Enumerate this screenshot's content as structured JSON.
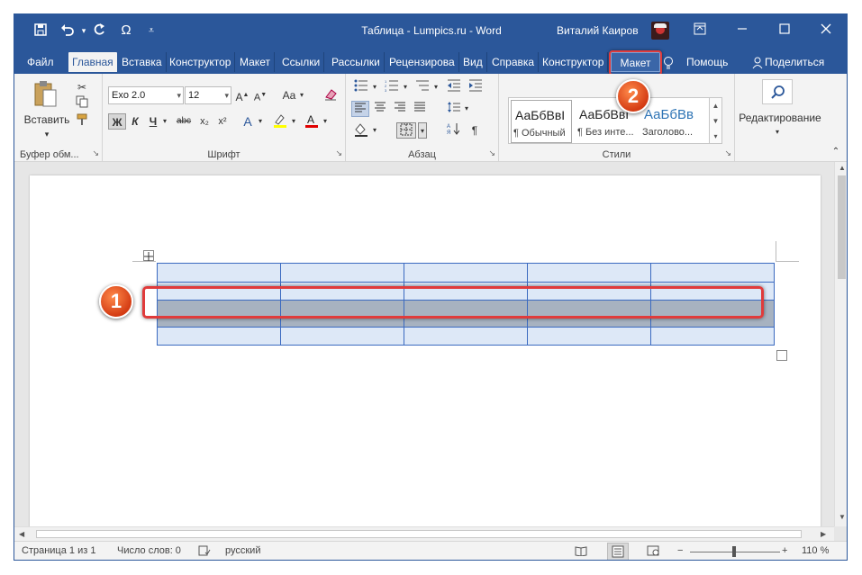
{
  "titlebar": {
    "title": "Таблица - Lumpics.ru  -  Word",
    "user": "Виталий Каиров",
    "qa_save_icon": "save-icon",
    "qa_undo_icon": "undo-icon",
    "qa_redo_icon": "redo-icon",
    "qa_symbol": "Ω",
    "qa_more": "⩡"
  },
  "tabs": [
    {
      "label": "Файл"
    },
    {
      "label": "Главная"
    },
    {
      "label": "Вставка"
    },
    {
      "label": "Конструктор"
    },
    {
      "label": "Макет"
    },
    {
      "label": "Ссылки"
    },
    {
      "label": "Рассылки"
    },
    {
      "label": "Рецензирова"
    },
    {
      "label": "Вид"
    },
    {
      "label": "Справка"
    },
    {
      "label": "Конструктор"
    },
    {
      "label": "Макет"
    },
    {
      "label": "Помощь"
    },
    {
      "label": "Поделиться"
    }
  ],
  "ribbon": {
    "clipboard": {
      "paste": "Вставить",
      "label": "Буфер обм..."
    },
    "font": {
      "name": "Exo 2.0",
      "size": "12",
      "aa": "Aa",
      "label": "Шрифт",
      "bold": "Ж",
      "italic": "К",
      "underline": "Ч",
      "strike": "abc",
      "sub": "x₂",
      "sup": "x²"
    },
    "paragraph": {
      "label": "Абзац",
      "pilcrow": "¶"
    },
    "styles": {
      "label": "Стили",
      "items": [
        {
          "sample": "АаБбВвІ",
          "name": "¶ Обычный"
        },
        {
          "sample": "АаБбВвІ",
          "name": "¶ Без инте..."
        },
        {
          "sample": "АаБбВв",
          "name": "Заголово..."
        }
      ]
    },
    "editing": {
      "label": "Редактирование"
    }
  },
  "badges": {
    "one": "1",
    "two": "2"
  },
  "status": {
    "page": "Страница 1 из 1",
    "words": "Число слов: 0",
    "language": "русский",
    "zoom": "110 %",
    "minus": "−",
    "plus": "+"
  }
}
